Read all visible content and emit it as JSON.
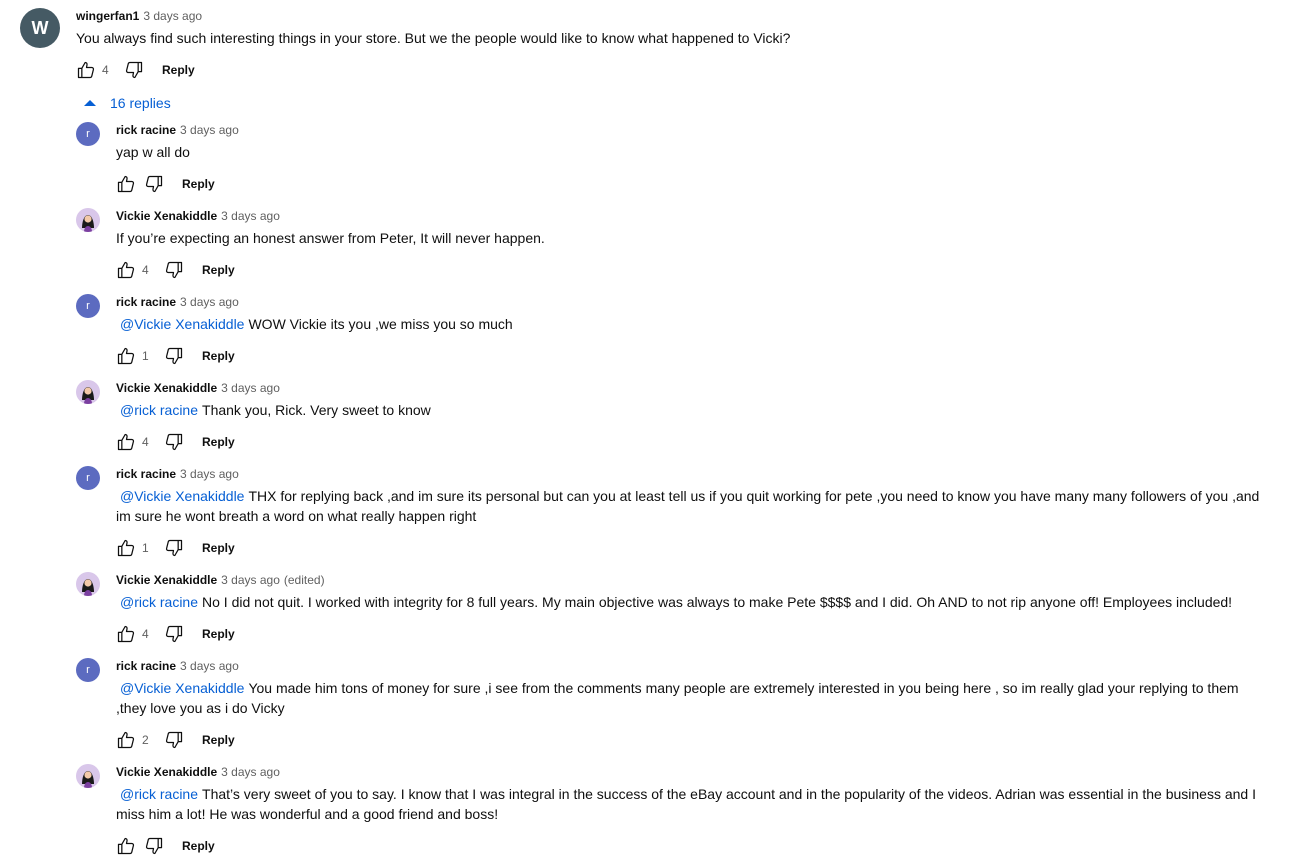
{
  "top_comment": {
    "avatar_letter": "W",
    "author": "wingerfan1",
    "time": "3 days ago",
    "text": "You always find such interesting things in your store. But we the people would like to know what happened to Vicki?",
    "likes": "4",
    "reply_label": "Reply"
  },
  "replies_toggle": {
    "label": "16 replies"
  },
  "replies": [
    {
      "author": "rick racine",
      "time": "3 days ago",
      "edited": "",
      "mention": "",
      "text": "yap w all do",
      "likes": "",
      "reply_label": "Reply",
      "avatar": "r"
    },
    {
      "author": "Vickie Xenakiddle",
      "time": "3 days ago",
      "edited": "",
      "mention": "",
      "text": "If you’re expecting an honest answer from Peter, It will never happen.",
      "likes": "4",
      "reply_label": "Reply",
      "avatar": ""
    },
    {
      "author": "rick racine",
      "time": "3 days ago",
      "edited": "",
      "mention": "@Vickie Xenakiddle",
      "text": "WOW Vickie its you ,we miss you so much",
      "likes": "1",
      "reply_label": "Reply",
      "avatar": "r"
    },
    {
      "author": "Vickie Xenakiddle",
      "time": "3 days ago",
      "edited": "",
      "mention": "@rick racine",
      "text": "Thank you, Rick. Very sweet to know",
      "likes": "4",
      "reply_label": "Reply",
      "avatar": ""
    },
    {
      "author": "rick racine",
      "time": "3 days ago",
      "edited": "",
      "mention": "@Vickie Xenakiddle",
      "text": "THX for replying back ,and im sure its personal but can you at least tell us if you quit working for pete ,you need to know you have many many followers of you ,and im sure he wont breath a word on what really happen right",
      "likes": "1",
      "reply_label": "Reply",
      "avatar": "r"
    },
    {
      "author": "Vickie Xenakiddle",
      "time": "3 days ago",
      "edited": "(edited)",
      "mention": "@rick racine",
      "text": "No I did not quit.  I worked with integrity for 8 full years. My main objective was always to make Pete $$$$ and I did. Oh AND to not rip anyone off! Employees included!",
      "likes": "4",
      "reply_label": "Reply",
      "avatar": ""
    },
    {
      "author": "rick racine",
      "time": "3 days ago",
      "edited": "",
      "mention": "@Vickie Xenakiddle",
      "text": "You made him tons of money for sure ,i see from the comments  many people are extremely interested in you being here , so im really glad your replying to them ,they love you as i do Vicky",
      "likes": "2",
      "reply_label": "Reply",
      "avatar": "r"
    },
    {
      "author": "Vickie Xenakiddle",
      "time": "3 days ago",
      "edited": "",
      "mention": "@rick racine",
      "text": "That’s very sweet of you to say. I know that I was integral in the success of the eBay account and in the popularity of the videos. Adrian was essential in the business and I miss him a lot! He was wonderful and a good friend and boss!",
      "likes": "",
      "reply_label": "Reply",
      "avatar": ""
    }
  ]
}
